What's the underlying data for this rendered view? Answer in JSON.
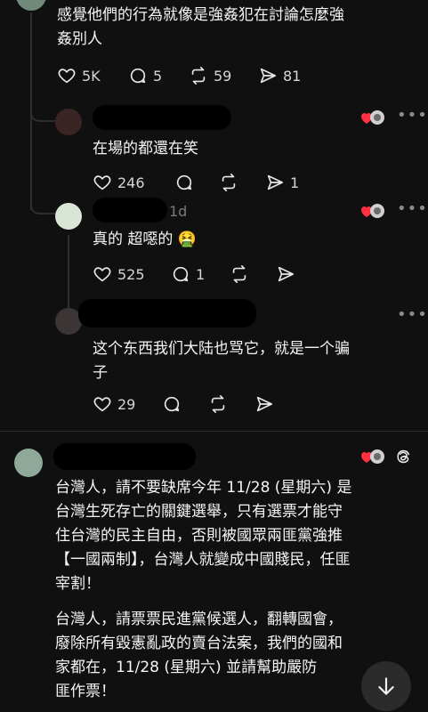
{
  "post1": {
    "text_lines": [
      "感覺他們的行為就像是強姦犯在討論怎麼強",
      "姦別人"
    ],
    "likes": "5K",
    "comments": "5",
    "reposts": "59",
    "shares": "81"
  },
  "reply1": {
    "text": "在場的都還在笑",
    "likes": "246",
    "shares": "1"
  },
  "reply2": {
    "time": "1d",
    "text": "真的 超噁的 🤮",
    "likes": "525",
    "comments": "1"
  },
  "reply3": {
    "text_lines": [
      "这个东西我们大陆也骂它，就是一个骗",
      "子"
    ],
    "likes": "29"
  },
  "post2": {
    "paragraph1": [
      "台灣人，請不要缺席今年 11/28 (星期六) 是",
      "台灣生死存亡的關鍵選舉，只有選票才能守",
      "住台灣的民主自由，否則被國眾兩匪黨強推",
      "【一國兩制】，台灣人就變成中國賤民，任匪",
      "宰割！"
    ],
    "paragraph2": [
      "台灣人，請票票民進黨候選人，翻轉國會，",
      "廢除所有毀憲亂政的賣台法案，我們的國和",
      "家都在，11/28 (星期六) 並請幫助嚴防",
      "匪作票！"
    ]
  },
  "icons": {
    "like": "heart-icon",
    "comment": "comment-icon",
    "repost": "repost-icon",
    "share": "share-icon",
    "more": "more-icon",
    "threads": "threads-icon",
    "scroll": "arrow-down-icon"
  },
  "colors": {
    "background": "#101010",
    "text": "#f3f5f7",
    "muted": "#7a7a7a",
    "heart": "#ff3040"
  }
}
